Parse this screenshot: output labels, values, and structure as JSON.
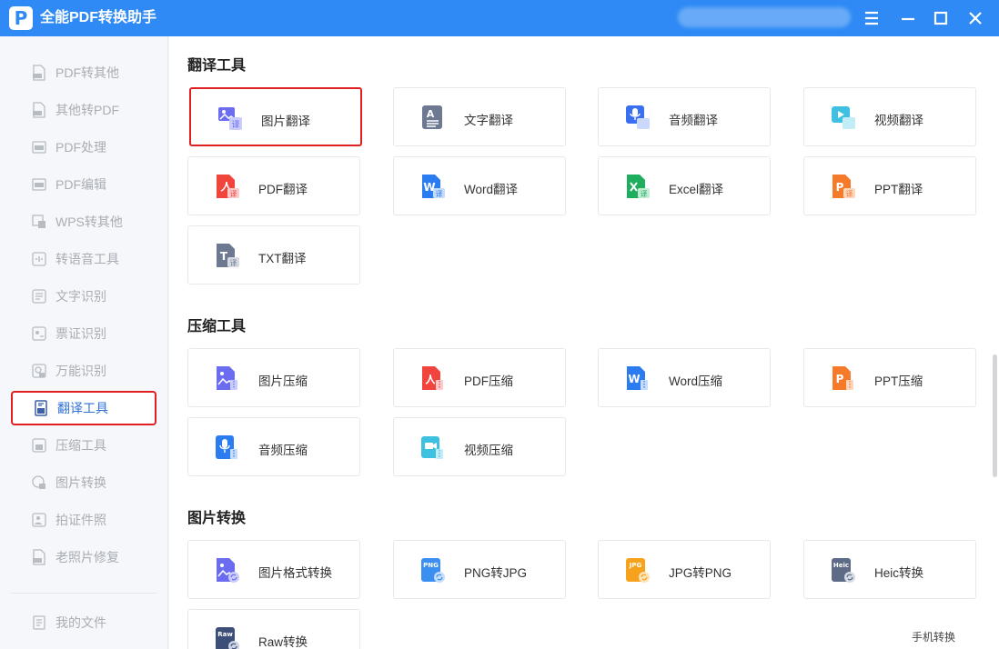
{
  "app": {
    "title": "全能PDF转换助手",
    "logo_letter": "P"
  },
  "sidebar": {
    "items": [
      {
        "label": "PDF转其他",
        "icon": "pdf-doc-icon",
        "active": false
      },
      {
        "label": "其他转PDF",
        "icon": "pdf-doc-icon",
        "active": false
      },
      {
        "label": "PDF处理",
        "icon": "pdf-process-icon",
        "active": false
      },
      {
        "label": "PDF编辑",
        "icon": "pdf-edit-icon",
        "active": false
      },
      {
        "label": "WPS转其他",
        "icon": "wps-icon",
        "active": false
      },
      {
        "label": "转语音工具",
        "icon": "speech-icon",
        "active": false
      },
      {
        "label": "文字识别",
        "icon": "ocr-icon",
        "active": false
      },
      {
        "label": "票证识别",
        "icon": "ticket-icon",
        "active": false
      },
      {
        "label": "万能识别",
        "icon": "scan-icon",
        "active": false
      },
      {
        "label": "翻译工具",
        "icon": "translate-icon",
        "active": true
      },
      {
        "label": "压缩工具",
        "icon": "compress-icon",
        "active": false
      },
      {
        "label": "图片转换",
        "icon": "image-convert-icon",
        "active": false
      },
      {
        "label": "拍证件照",
        "icon": "id-photo-icon",
        "active": false
      },
      {
        "label": "老照片修复",
        "icon": "photo-repair-icon",
        "active": false
      }
    ],
    "my_files": {
      "label": "我的文件",
      "icon": "file-icon"
    }
  },
  "sections": {
    "translate": {
      "title": "翻译工具",
      "tools": [
        {
          "label": "图片翻译",
          "icon": "image-translate-icon"
        },
        {
          "label": "文字翻译",
          "icon": "text-translate-icon"
        },
        {
          "label": "音频翻译",
          "icon": "audio-translate-icon"
        },
        {
          "label": "视频翻译",
          "icon": "video-translate-icon"
        },
        {
          "label": "PDF翻译",
          "icon": "pdf-translate-icon"
        },
        {
          "label": "Word翻译",
          "icon": "word-translate-icon"
        },
        {
          "label": "Excel翻译",
          "icon": "excel-translate-icon"
        },
        {
          "label": "PPT翻译",
          "icon": "ppt-translate-icon"
        },
        {
          "label": "TXT翻译",
          "icon": "txt-translate-icon"
        }
      ]
    },
    "compress": {
      "title": "压缩工具",
      "tools": [
        {
          "label": "图片压缩",
          "icon": "image-compress-icon"
        },
        {
          "label": "PDF压缩",
          "icon": "pdf-compress-icon"
        },
        {
          "label": "Word压缩",
          "icon": "word-compress-icon"
        },
        {
          "label": "PPT压缩",
          "icon": "ppt-compress-icon"
        },
        {
          "label": "音频压缩",
          "icon": "audio-compress-icon"
        },
        {
          "label": "视频压缩",
          "icon": "video-compress-icon"
        }
      ]
    },
    "image_convert": {
      "title": "图片转换",
      "tools": [
        {
          "label": "图片格式转换",
          "icon": "image-format-icon"
        },
        {
          "label": "PNG转JPG",
          "icon": "png-icon",
          "badge": "PNG"
        },
        {
          "label": "JPG转PNG",
          "icon": "jpg-icon",
          "badge": "JPG"
        },
        {
          "label": "Heic转换",
          "icon": "heic-icon",
          "badge": "Heic"
        },
        {
          "label": "Raw转换",
          "icon": "raw-icon",
          "badge": "Raw"
        }
      ]
    }
  },
  "footer": {
    "phone_convert": "手机转换"
  },
  "colors": {
    "titlebar": "#2f8af5",
    "active_text": "#2f6fd6",
    "highlight_border": "#e02020",
    "pdf_red": "#f0443c",
    "word_blue": "#2b7cf0",
    "excel_green": "#1fae5e",
    "ppt_orange": "#f57a2a",
    "image_purple": "#6b6cf0",
    "txt_slate": "#6d7891",
    "video_cyan": "#3ec0e0",
    "png_blue": "#3a8ff0",
    "jpg_orange": "#f7a21c",
    "heic_slate": "#5d6b86",
    "raw_navy": "#3d4f78"
  }
}
